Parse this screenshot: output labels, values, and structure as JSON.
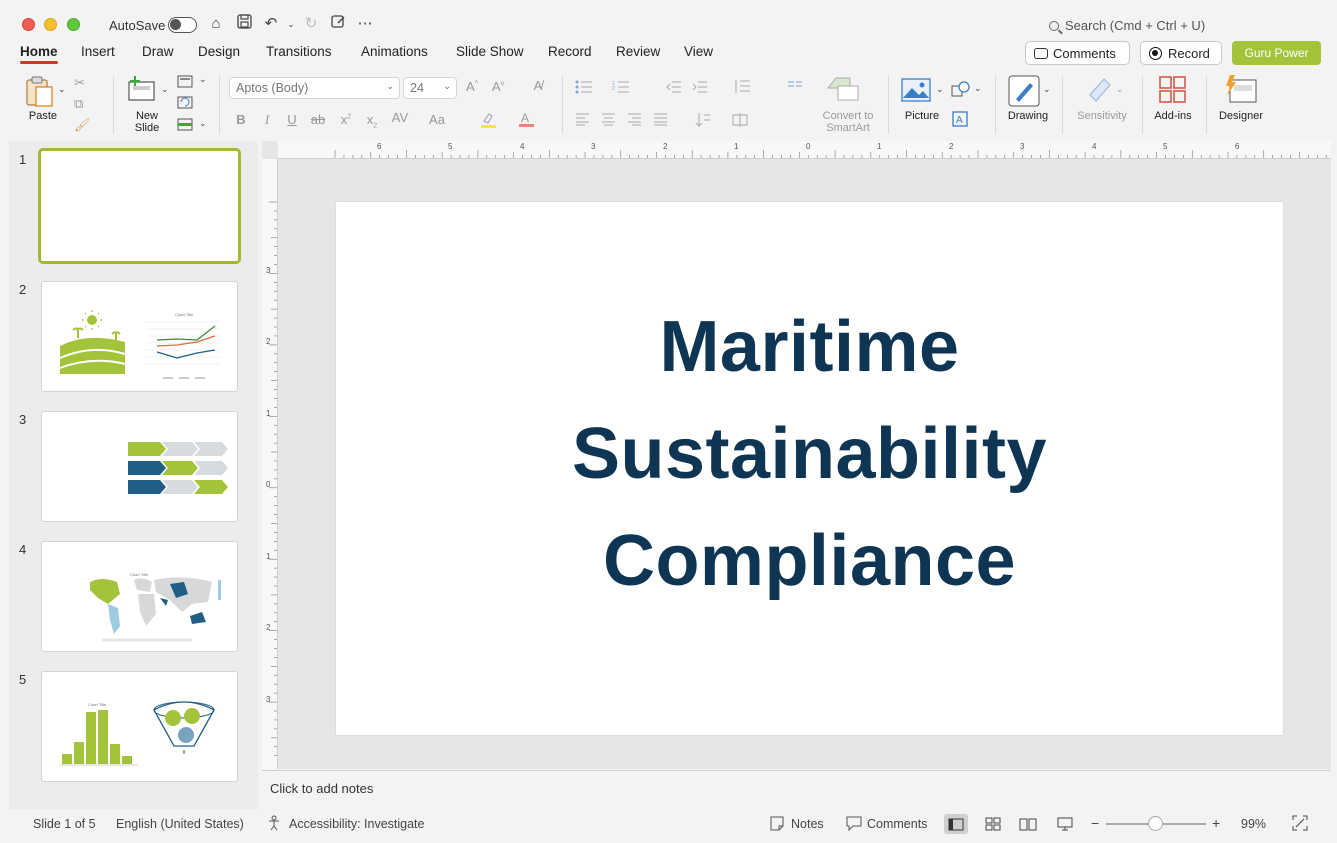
{
  "titlebar": {
    "autosave_label": "AutoSave",
    "search_placeholder": "Search (Cmd + Ctrl + U)"
  },
  "tabs": [
    "Home",
    "Insert",
    "Draw",
    "Design",
    "Transitions",
    "Animations",
    "Slide Show",
    "Record",
    "Review",
    "View"
  ],
  "active_tab": "Home",
  "top_buttons": {
    "comments": "Comments",
    "record": "Record",
    "guru": "Guru Power"
  },
  "ribbon": {
    "paste": "Paste",
    "new_slide_line1": "New",
    "new_slide_line2": "Slide",
    "font_name": "Aptos (Body)",
    "font_size": "24",
    "convert_line1": "Convert to",
    "convert_line2": "SmartArt",
    "picture": "Picture",
    "drawing": "Drawing",
    "sensitivity": "Sensitivity",
    "addins": "Add-ins",
    "designer": "Designer"
  },
  "thumbnails": [
    "1",
    "2",
    "3",
    "4",
    "5"
  ],
  "thumb_texts": {
    "chart_title": "Chart Title"
  },
  "slide": {
    "title_lines": [
      "Maritime",
      "Sustainability",
      "Compliance"
    ]
  },
  "notes_placeholder": "Click to add notes",
  "status": {
    "slide_info": "Slide 1 of 5",
    "language": "English (United States)",
    "accessibility": "Accessibility: Investigate",
    "notes": "Notes",
    "comments": "Comments",
    "zoom_minus": "−",
    "zoom_plus": "+",
    "zoom": "99%"
  },
  "ruler": {
    "h": [
      "6",
      "5",
      "4",
      "3",
      "2",
      "1",
      "0",
      "1",
      "2",
      "3",
      "4",
      "5",
      "6"
    ],
    "v": [
      "3",
      "2",
      "1",
      "0",
      "1",
      "2",
      "3"
    ]
  },
  "colors": {
    "accent_green": "#a3c43a",
    "title_navy": "#0e3553",
    "active_tab_underline": "#c43e1c",
    "chart_blue": "#1f5f86"
  }
}
